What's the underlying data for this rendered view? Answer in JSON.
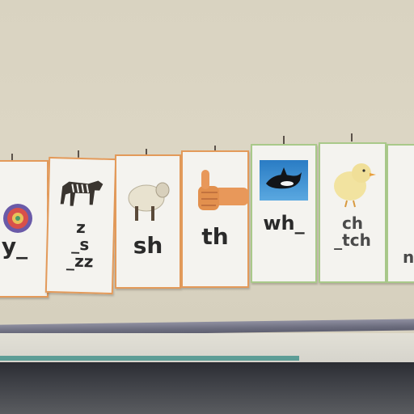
{
  "cards": [
    {
      "id": "y",
      "lines": [
        "y_"
      ]
    },
    {
      "id": "z",
      "lines": [
        "z",
        "_s",
        "_zz"
      ]
    },
    {
      "id": "sh",
      "lines": [
        "sh"
      ]
    },
    {
      "id": "th",
      "lines": [
        "th"
      ]
    },
    {
      "id": "wh",
      "lines": [
        "wh_"
      ]
    },
    {
      "id": "ch",
      "lines": [
        "ch",
        "_tch"
      ]
    },
    {
      "id": "n",
      "lines": [
        "n"
      ]
    }
  ],
  "colors": {
    "wall": "#d9d3c1",
    "card_border_orange": "#e39a5a",
    "card_border_green": "#a9c98a",
    "text": "#2a2a2a"
  }
}
